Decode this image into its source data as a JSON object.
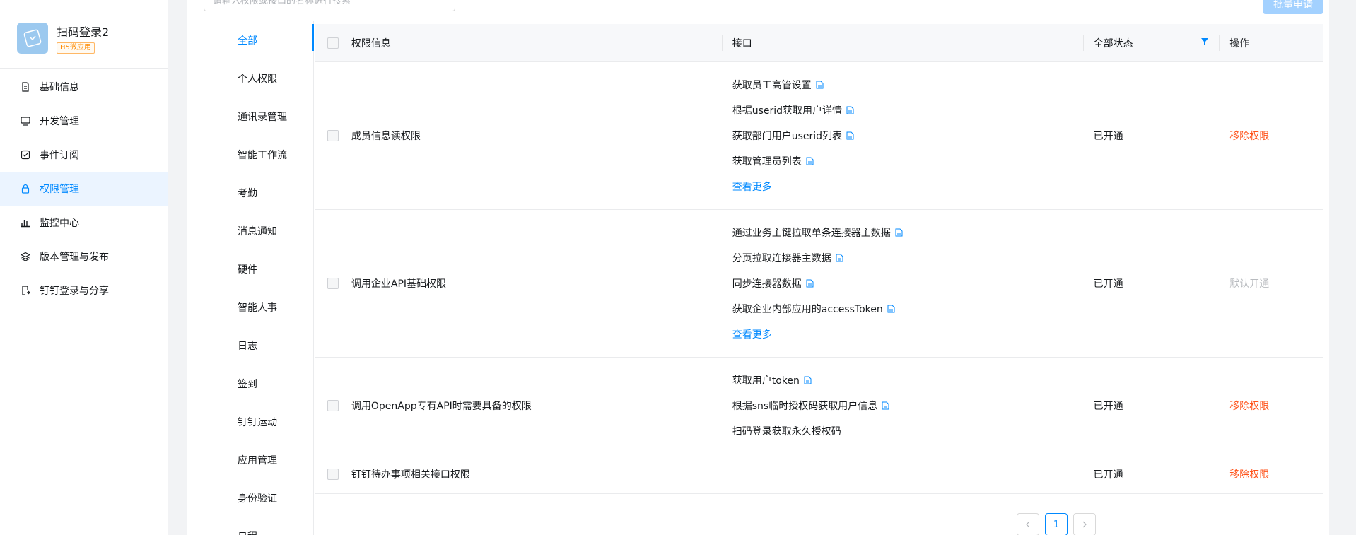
{
  "app": {
    "name": "扫码登录2",
    "badge": "H5微应用"
  },
  "nav": {
    "items": [
      {
        "label": "基础信息",
        "icon": "document-icon",
        "active": false
      },
      {
        "label": "开发管理",
        "icon": "monitor-icon",
        "active": false
      },
      {
        "label": "事件订阅",
        "icon": "check-square-icon",
        "active": false
      },
      {
        "label": "权限管理",
        "icon": "lock-icon",
        "active": true
      },
      {
        "label": "监控中心",
        "icon": "bar-chart-icon",
        "active": false
      },
      {
        "label": "版本管理与发布",
        "icon": "layers-icon",
        "active": false
      },
      {
        "label": "钉钉登录与分享",
        "icon": "share-doc-icon",
        "active": false
      }
    ]
  },
  "search": {
    "placeholder": "请输入权限或接口的名称进行搜索"
  },
  "toolbar": {
    "batch_label": "批量申请"
  },
  "categories": [
    "全部",
    "个人权限",
    "通讯录管理",
    "智能工作流",
    "考勤",
    "消息通知",
    "硬件",
    "智能人事",
    "日志",
    "签到",
    "钉钉运动",
    "应用管理",
    "身份验证",
    "日程"
  ],
  "table": {
    "headers": {
      "info": "权限信息",
      "api": "接口",
      "status": "全部状态",
      "op": "操作"
    },
    "rows": [
      {
        "name": "成员信息读权限",
        "apis": [
          "获取员工高管设置",
          "根据userid获取用户详情",
          "获取部门用户userid列表",
          "获取管理员列表"
        ],
        "more": "查看更多",
        "status": "已开通",
        "op": "移除权限",
        "op_type": "remove"
      },
      {
        "name": "调用企业API基础权限",
        "apis": [
          "通过业务主键拉取单条连接器主数据",
          "分页拉取连接器主数据",
          "同步连接器数据",
          "获取企业内部应用的accessToken"
        ],
        "more": "查看更多",
        "status": "已开通",
        "op": "默认开通",
        "op_type": "default"
      },
      {
        "name": "调用OpenApp专有API时需要具备的权限",
        "apis": [
          "获取用户token",
          "根据sns临时授权码获取用户信息",
          "扫码登录获取永久授权码"
        ],
        "more": "",
        "status": "已开通",
        "op": "移除权限",
        "op_type": "remove"
      },
      {
        "name": "钉钉待办事项相关接口权限",
        "apis": [],
        "more": "",
        "status": "已开通",
        "op": "移除权限",
        "op_type": "remove"
      }
    ]
  },
  "pagination": {
    "current": "1"
  },
  "colors": {
    "accent": "#0089ff",
    "danger": "#ff5219",
    "muted": "#b8bbbf"
  }
}
